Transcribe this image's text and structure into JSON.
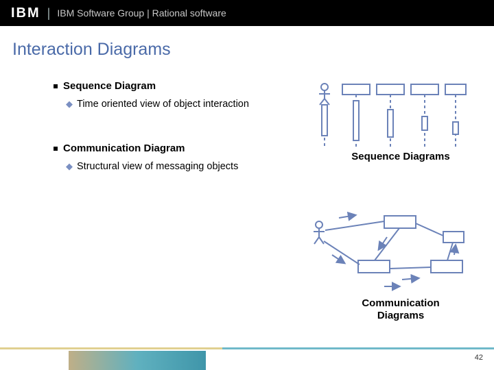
{
  "topbar": {
    "logo": "IBM",
    "text": "IBM Software Group | Rational software"
  },
  "title": "Interaction Diagrams",
  "sections": [
    {
      "head": "Sequence Diagram",
      "sub": "Time oriented view of object interaction"
    },
    {
      "head": "Communication Diagram",
      "sub": "Structural view of messaging objects"
    }
  ],
  "captions": {
    "seq": "Sequence Diagrams",
    "comm": "Communication Diagrams"
  },
  "page": "42"
}
